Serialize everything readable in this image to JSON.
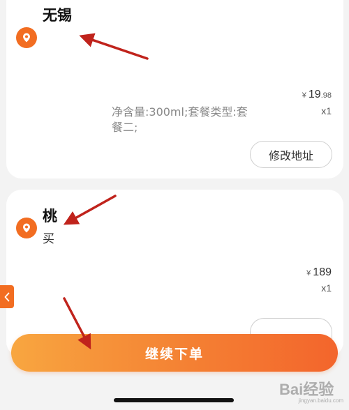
{
  "order_1": {
    "name": "无锡",
    "price_currency": "¥",
    "price_integer": "19",
    "price_decimal": ".98",
    "quantity": "x1",
    "spec": "净含量:300ml;套餐类型:套餐二;",
    "edit_address_label": "修改地址"
  },
  "order_2": {
    "name": "桃",
    "subtitle": "买",
    "price_currency": "¥",
    "price_integer": "189",
    "quantity": "x1"
  },
  "footer": {
    "continue_order_label": "继续下单"
  },
  "watermark": {
    "brand": "Bai经验",
    "url": "jingyan.baidu.com"
  },
  "colors": {
    "accent": "#f26d21",
    "button_gradient_start": "#f8a640",
    "button_gradient_end": "#f3652c",
    "annotation_arrow": "#c0231c"
  },
  "icons": {
    "location": "location-pin-icon",
    "side_tab": "chevron-left-icon"
  }
}
